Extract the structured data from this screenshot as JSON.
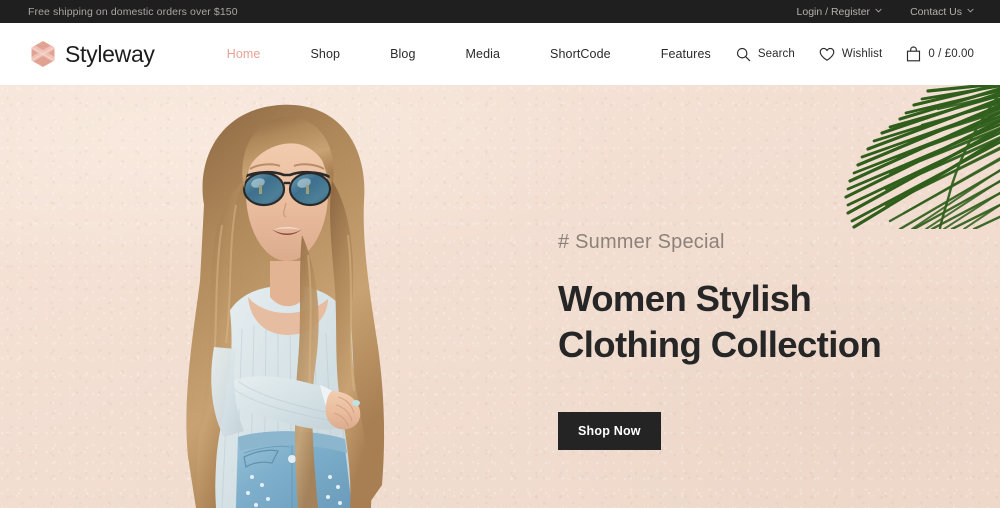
{
  "announcement": {
    "message": "Free shipping on domestic orders over $150",
    "links": [
      {
        "label": "Login / Register",
        "icon": "chevron-down-icon"
      },
      {
        "label": "Contact Us",
        "icon": "chevron-down-icon"
      }
    ]
  },
  "header": {
    "brand": {
      "name": "Styleway",
      "icon": "hexagon-logo-icon"
    },
    "nav": [
      {
        "label": "Home",
        "active": true
      },
      {
        "label": "Shop",
        "active": false
      },
      {
        "label": "Blog",
        "active": false
      },
      {
        "label": "Media",
        "active": false
      },
      {
        "label": "ShortCode",
        "active": false
      },
      {
        "label": "Features",
        "active": false
      }
    ],
    "utilities": [
      {
        "label": "Search",
        "icon": "search-icon"
      },
      {
        "label": "Wishlist",
        "icon": "heart-icon"
      },
      {
        "label": "0 / £0.00",
        "icon": "shopping-bag-icon"
      }
    ]
  },
  "hero": {
    "eyebrow": "# Summer Special",
    "headline_line1": "Women Stylish",
    "headline_line2": "Clothing Collection",
    "cta_label": "Shop Now",
    "image_alt": "Woman in light blue off-shoulder top, blue jeans and mirrored sunglasses leaning against a blush wall",
    "decoration": "palm-leaf"
  },
  "colors": {
    "accent": "#e8a294",
    "dark": "#1f1f1f",
    "hero_background": "#f2ded1",
    "cta_background": "#242424",
    "palm_green": "#2f5a1e"
  }
}
